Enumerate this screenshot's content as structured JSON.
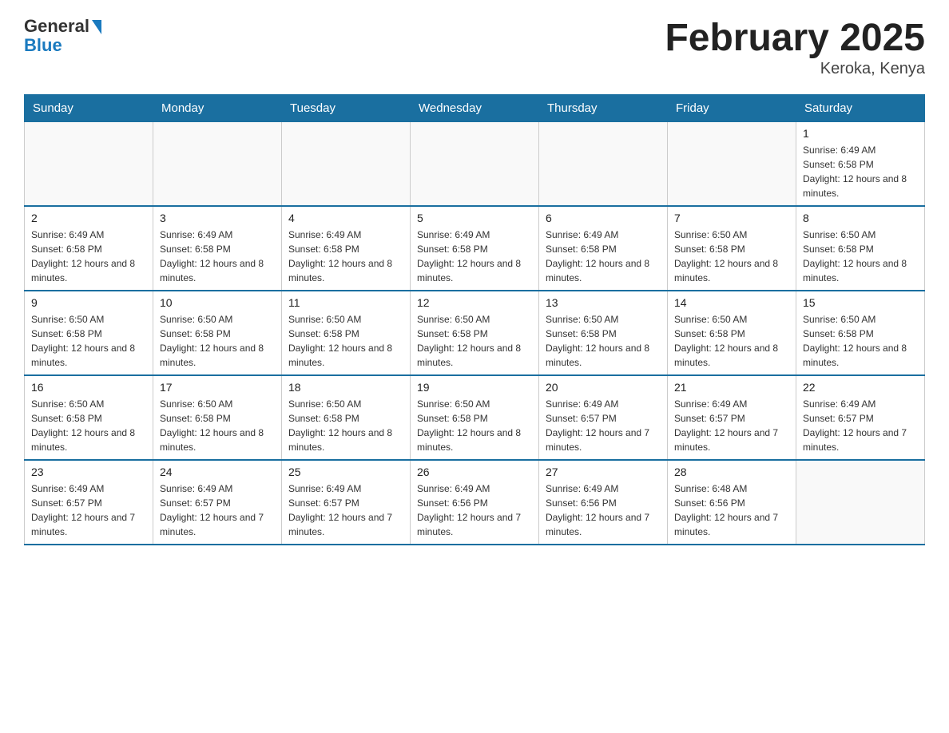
{
  "header": {
    "logo_general": "General",
    "logo_blue": "Blue",
    "title": "February 2025",
    "subtitle": "Keroka, Kenya"
  },
  "days_of_week": [
    "Sunday",
    "Monday",
    "Tuesday",
    "Wednesday",
    "Thursday",
    "Friday",
    "Saturday"
  ],
  "weeks": [
    {
      "days": [
        {
          "num": "",
          "info": ""
        },
        {
          "num": "",
          "info": ""
        },
        {
          "num": "",
          "info": ""
        },
        {
          "num": "",
          "info": ""
        },
        {
          "num": "",
          "info": ""
        },
        {
          "num": "",
          "info": ""
        },
        {
          "num": "1",
          "info": "Sunrise: 6:49 AM\nSunset: 6:58 PM\nDaylight: 12 hours and 8 minutes."
        }
      ]
    },
    {
      "days": [
        {
          "num": "2",
          "info": "Sunrise: 6:49 AM\nSunset: 6:58 PM\nDaylight: 12 hours and 8 minutes."
        },
        {
          "num": "3",
          "info": "Sunrise: 6:49 AM\nSunset: 6:58 PM\nDaylight: 12 hours and 8 minutes."
        },
        {
          "num": "4",
          "info": "Sunrise: 6:49 AM\nSunset: 6:58 PM\nDaylight: 12 hours and 8 minutes."
        },
        {
          "num": "5",
          "info": "Sunrise: 6:49 AM\nSunset: 6:58 PM\nDaylight: 12 hours and 8 minutes."
        },
        {
          "num": "6",
          "info": "Sunrise: 6:49 AM\nSunset: 6:58 PM\nDaylight: 12 hours and 8 minutes."
        },
        {
          "num": "7",
          "info": "Sunrise: 6:50 AM\nSunset: 6:58 PM\nDaylight: 12 hours and 8 minutes."
        },
        {
          "num": "8",
          "info": "Sunrise: 6:50 AM\nSunset: 6:58 PM\nDaylight: 12 hours and 8 minutes."
        }
      ]
    },
    {
      "days": [
        {
          "num": "9",
          "info": "Sunrise: 6:50 AM\nSunset: 6:58 PM\nDaylight: 12 hours and 8 minutes."
        },
        {
          "num": "10",
          "info": "Sunrise: 6:50 AM\nSunset: 6:58 PM\nDaylight: 12 hours and 8 minutes."
        },
        {
          "num": "11",
          "info": "Sunrise: 6:50 AM\nSunset: 6:58 PM\nDaylight: 12 hours and 8 minutes."
        },
        {
          "num": "12",
          "info": "Sunrise: 6:50 AM\nSunset: 6:58 PM\nDaylight: 12 hours and 8 minutes."
        },
        {
          "num": "13",
          "info": "Sunrise: 6:50 AM\nSunset: 6:58 PM\nDaylight: 12 hours and 8 minutes."
        },
        {
          "num": "14",
          "info": "Sunrise: 6:50 AM\nSunset: 6:58 PM\nDaylight: 12 hours and 8 minutes."
        },
        {
          "num": "15",
          "info": "Sunrise: 6:50 AM\nSunset: 6:58 PM\nDaylight: 12 hours and 8 minutes."
        }
      ]
    },
    {
      "days": [
        {
          "num": "16",
          "info": "Sunrise: 6:50 AM\nSunset: 6:58 PM\nDaylight: 12 hours and 8 minutes."
        },
        {
          "num": "17",
          "info": "Sunrise: 6:50 AM\nSunset: 6:58 PM\nDaylight: 12 hours and 8 minutes."
        },
        {
          "num": "18",
          "info": "Sunrise: 6:50 AM\nSunset: 6:58 PM\nDaylight: 12 hours and 8 minutes."
        },
        {
          "num": "19",
          "info": "Sunrise: 6:50 AM\nSunset: 6:58 PM\nDaylight: 12 hours and 8 minutes."
        },
        {
          "num": "20",
          "info": "Sunrise: 6:49 AM\nSunset: 6:57 PM\nDaylight: 12 hours and 7 minutes."
        },
        {
          "num": "21",
          "info": "Sunrise: 6:49 AM\nSunset: 6:57 PM\nDaylight: 12 hours and 7 minutes."
        },
        {
          "num": "22",
          "info": "Sunrise: 6:49 AM\nSunset: 6:57 PM\nDaylight: 12 hours and 7 minutes."
        }
      ]
    },
    {
      "days": [
        {
          "num": "23",
          "info": "Sunrise: 6:49 AM\nSunset: 6:57 PM\nDaylight: 12 hours and 7 minutes."
        },
        {
          "num": "24",
          "info": "Sunrise: 6:49 AM\nSunset: 6:57 PM\nDaylight: 12 hours and 7 minutes."
        },
        {
          "num": "25",
          "info": "Sunrise: 6:49 AM\nSunset: 6:57 PM\nDaylight: 12 hours and 7 minutes."
        },
        {
          "num": "26",
          "info": "Sunrise: 6:49 AM\nSunset: 6:56 PM\nDaylight: 12 hours and 7 minutes."
        },
        {
          "num": "27",
          "info": "Sunrise: 6:49 AM\nSunset: 6:56 PM\nDaylight: 12 hours and 7 minutes."
        },
        {
          "num": "28",
          "info": "Sunrise: 6:48 AM\nSunset: 6:56 PM\nDaylight: 12 hours and 7 minutes."
        },
        {
          "num": "",
          "info": ""
        }
      ]
    }
  ]
}
